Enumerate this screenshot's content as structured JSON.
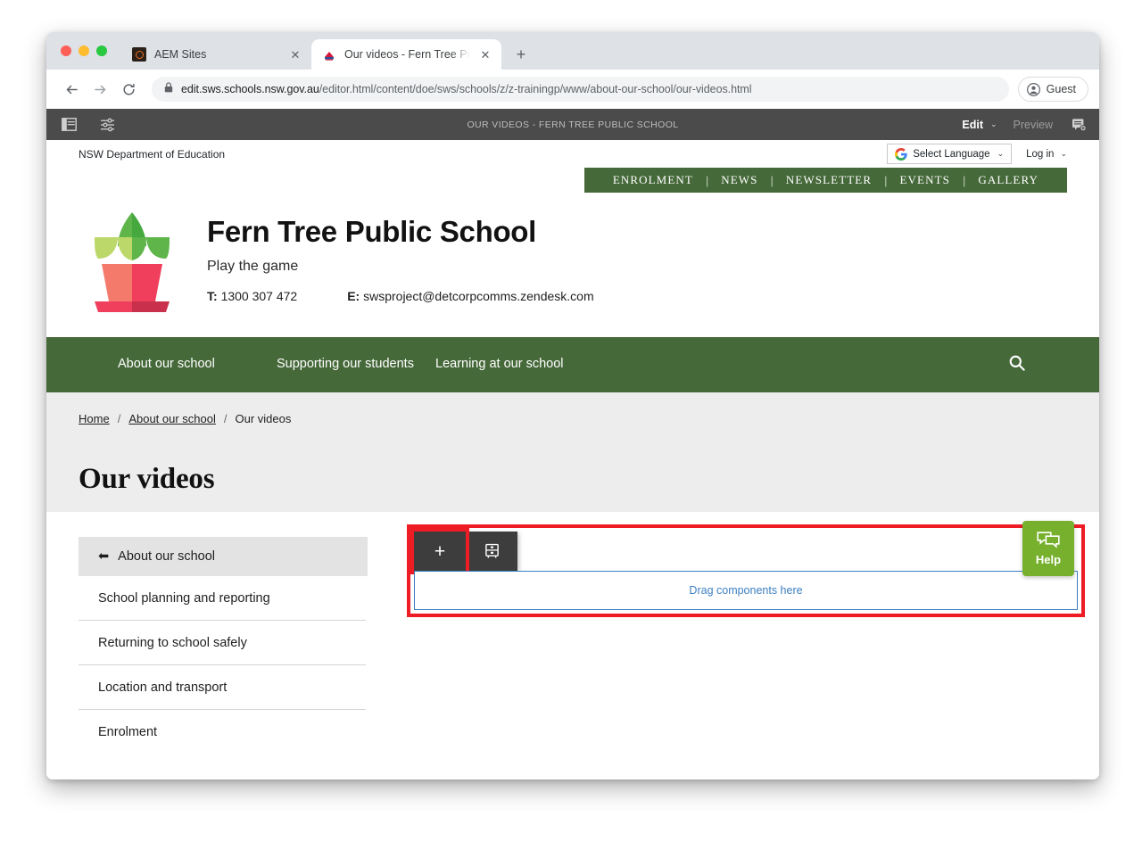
{
  "browser": {
    "tabs": [
      {
        "title": "AEM Sites",
        "favicon": "aem-icon",
        "active": false
      },
      {
        "title": "Our videos - Fern Tree Public S",
        "favicon": "nsw-icon",
        "active": true
      }
    ],
    "new_tab_label": "+",
    "close_label": "✕",
    "url_host": "edit.sws.schools.nsw.gov.au",
    "url_path": "/editor.html/content/doe/sws/schools/z/z-trainingp/www/about-our-school/our-videos.html",
    "profile_label": "Guest"
  },
  "aem": {
    "page_title": "OUR VIDEOS - FERN TREE PUBLIC SCHOOL",
    "edit_label": "Edit",
    "edit_caret": "⌄",
    "preview_label": "Preview",
    "icons": {
      "rail": "sidebar-rail-icon",
      "properties": "page-properties-icon",
      "annotations": "annotations-icon"
    },
    "toolbar": {
      "insert_label": "+",
      "layout_icon": "layout-container-icon"
    },
    "dropzone_label": "Drag components here",
    "highlight_color": "#ee1c25",
    "dropzone_border_color": "#3d7fc1"
  },
  "site": {
    "department": "NSW Department of Education",
    "language_select": "Select Language",
    "login": "Log in",
    "caret": "⌄",
    "utility_nav": [
      "ENROLMENT",
      "NEWS",
      "NEWSLETTER",
      "EVENTS",
      "GALLERY"
    ],
    "school_name": "Fern Tree Public School",
    "tagline": "Play the game",
    "phone_label": "T:",
    "phone": "1300 307 472",
    "email_label": "E:",
    "email": "swsproject@detcorpcomms.zendesk.com",
    "main_nav": [
      "About our school",
      "Supporting our students",
      "Learning at our school"
    ],
    "search_icon": "search-icon",
    "breadcrumb": [
      "Home",
      "About our school",
      "Our videos"
    ],
    "breadcrumb_separator": "/",
    "page_heading": "Our videos",
    "left_nav_header": "About our school",
    "left_nav_back_arrow": "⬅",
    "left_nav_items": [
      "School planning and reporting",
      "Returning to school safely",
      "Location and transport",
      "Enrolment"
    ],
    "help_label": "Help",
    "brand_green": "#46693a",
    "help_green": "#76b02c"
  }
}
